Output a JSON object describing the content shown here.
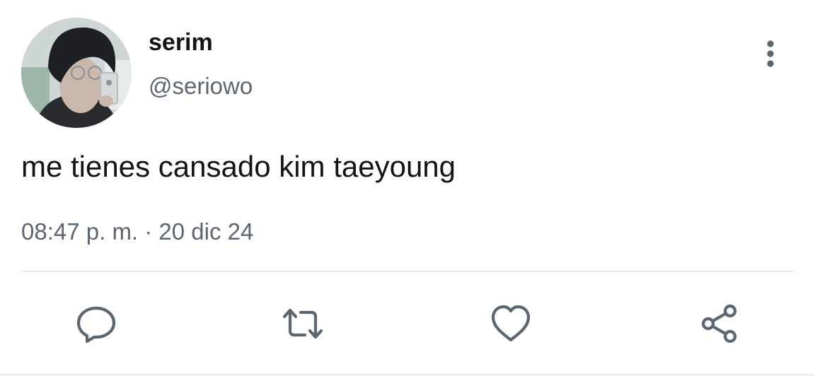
{
  "author": {
    "display_name": "serim",
    "handle": "@seriowo"
  },
  "tweet": {
    "text": "me tienes cansado kim taeyoung",
    "timestamp": "08:47 p. m. · 20 dic 24"
  },
  "icons": {
    "more": "more-vertical-icon",
    "reply": "reply-icon",
    "retweet": "retweet-icon",
    "like": "heart-icon",
    "share": "share-icon"
  },
  "colors": {
    "text_primary": "#141414",
    "text_secondary": "#5b6671",
    "icon": "#5b6671",
    "divider": "#e6e9ec"
  }
}
